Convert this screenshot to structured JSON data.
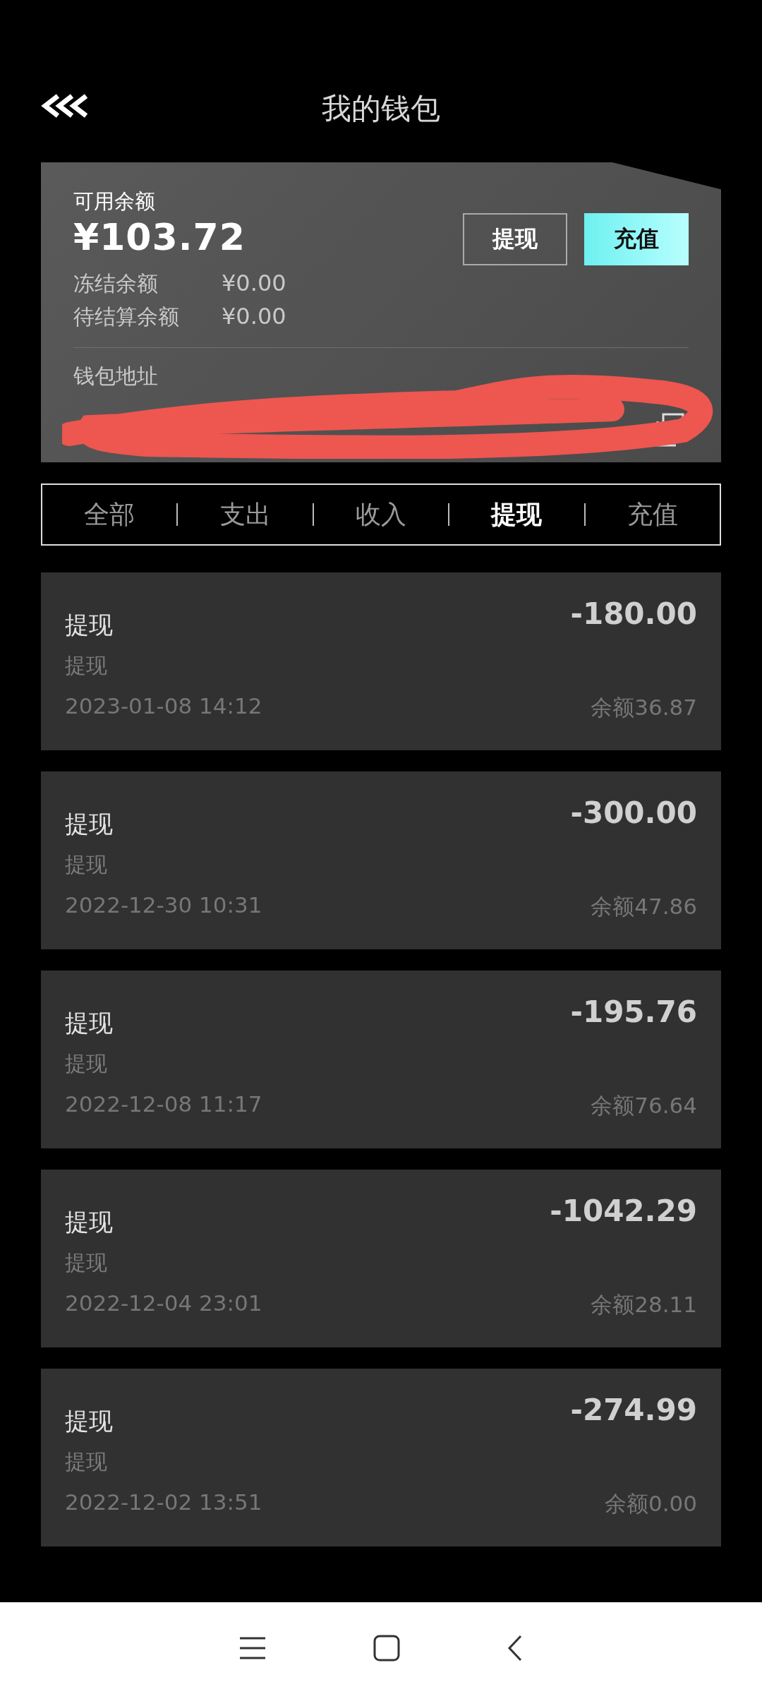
{
  "header": {
    "title": "我的钱包"
  },
  "wallet": {
    "available_label": "可用余额",
    "available_amount": "¥103.72",
    "withdraw_button": "提现",
    "recharge_button": "充值",
    "rows": [
      {
        "label": "冻结余额",
        "value": "¥0.00"
      },
      {
        "label": "待结算余额",
        "value": "¥0.00"
      }
    ],
    "address_label": "钱包地址"
  },
  "tabs": [
    {
      "label": "全部",
      "selected": false
    },
    {
      "label": "支出",
      "selected": false
    },
    {
      "label": "收入",
      "selected": false
    },
    {
      "label": "提现",
      "selected": true
    },
    {
      "label": "充值",
      "selected": false
    }
  ],
  "records": [
    {
      "title": "提现",
      "subtitle": "提现",
      "amount": "-180.00",
      "time": "2023-01-08 14:12",
      "balance": "余额36.87"
    },
    {
      "title": "提现",
      "subtitle": "提现",
      "amount": "-300.00",
      "time": "2022-12-30 10:31",
      "balance": "余额47.86"
    },
    {
      "title": "提现",
      "subtitle": "提现",
      "amount": "-195.76",
      "time": "2022-12-08 11:17",
      "balance": "余额76.64"
    },
    {
      "title": "提现",
      "subtitle": "提现",
      "amount": "-1042.29",
      "time": "2022-12-04 23:01",
      "balance": "余额28.11"
    },
    {
      "title": "提现",
      "subtitle": "提现",
      "amount": "-274.99",
      "time": "2022-12-02 13:51",
      "balance": "余额0.00"
    }
  ]
}
